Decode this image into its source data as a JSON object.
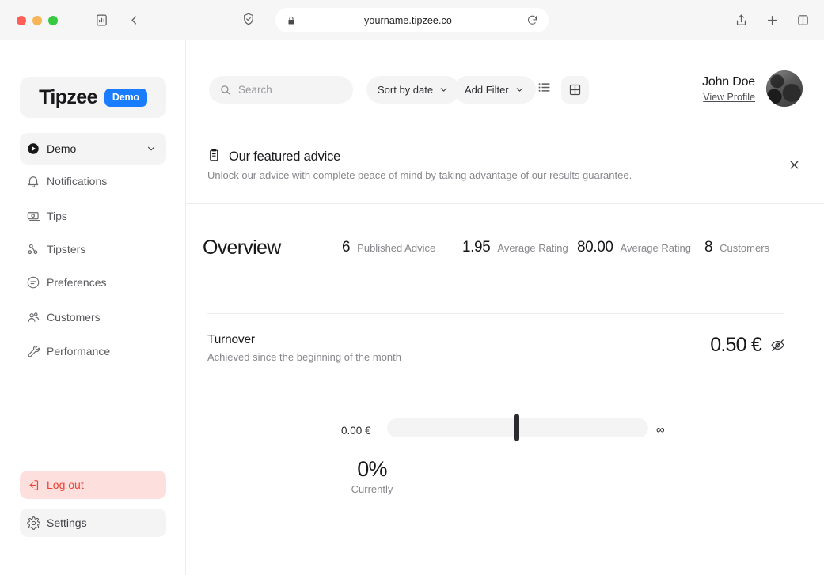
{
  "browser": {
    "url": "yourname.tipzee.co",
    "icons": {
      "sidebar_toggle": "sidebar-toggle-icon",
      "back": "back-chevron-icon",
      "shield": "shield-icon",
      "lock": "lock-icon",
      "reload": "reload-icon",
      "share": "share-icon",
      "new_tab": "plus-icon",
      "tab_overview": "tab-overview-icon"
    }
  },
  "sidebar": {
    "brand": {
      "name": "Tipzee",
      "badge": "Demo",
      "badge_color": "#1a7cff"
    },
    "workspace": {
      "label": "Demo",
      "icon": "play-circle-icon"
    },
    "items": [
      {
        "label": "Notifications",
        "icon": "bell-icon"
      },
      {
        "label": "Tips",
        "icon": "banknote-icon"
      },
      {
        "label": "Tipsters",
        "icon": "tipsters-icon"
      },
      {
        "label": "Preferences",
        "icon": "sliders-circle-icon"
      },
      {
        "label": "Customers",
        "icon": "users-icon"
      },
      {
        "label": "Performance",
        "icon": "wrench-icon"
      }
    ],
    "footer": [
      {
        "label": "Log out",
        "icon": "logout-icon",
        "color": "#ef4136",
        "background": "#fde0de"
      },
      {
        "label": "Settings",
        "icon": "gear-icon",
        "color": "#3f3f44",
        "background": "#f4f4f4"
      }
    ]
  },
  "header": {
    "search_placeholder": "Search",
    "search_value": "",
    "sort_label": "Sort by date",
    "filter_label": "Add Filter",
    "view_list_icon": "list-view-icon",
    "view_grid_icon": "grid-view-icon",
    "user": {
      "name": "John Doe",
      "link": "View Profile"
    }
  },
  "banner": {
    "icon": "clipboard-icon",
    "title": "Our featured advice",
    "subtitle": "Unlock our advice with complete peace of mind by taking advantage of our results guarantee.",
    "close_icon": "close-icon"
  },
  "overview": {
    "title": "Overview",
    "stats": [
      {
        "value": "6",
        "label": "Published Advice"
      },
      {
        "value": "1.95",
        "label": "Average Rating"
      },
      {
        "value": "80.00",
        "label": "Average Rating"
      },
      {
        "value": "8",
        "label": "Customers"
      }
    ]
  },
  "turnover": {
    "title": "Turnover",
    "subtitle": "Achieved since the beginning of the month",
    "value": "0.50 €",
    "toggle_icon": "eye-off-icon"
  },
  "progress": {
    "min_label": "0.00 €",
    "max_label": "∞",
    "percent": "0%",
    "caption": "Currently"
  }
}
